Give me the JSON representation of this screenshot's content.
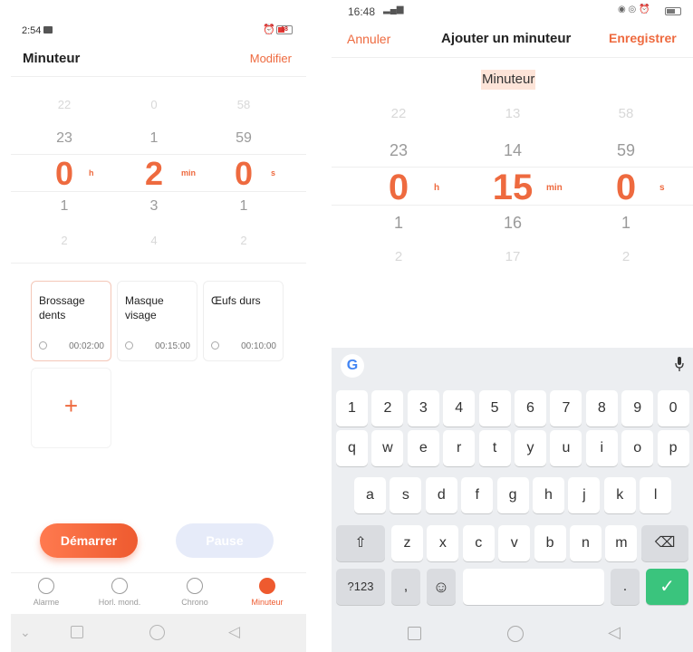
{
  "left": {
    "status": {
      "time": "2:54",
      "battery": "18"
    },
    "title": "Minuteur",
    "edit_label": "Modifier",
    "picker": {
      "hours": [
        "22",
        "23",
        "0",
        "1",
        "2"
      ],
      "minutes": [
        "0",
        "1",
        "2",
        "3",
        "4"
      ],
      "seconds": [
        "58",
        "59",
        "0",
        "1",
        "2"
      ],
      "units": {
        "h": "h",
        "min": "min",
        "s": "s"
      }
    },
    "presets": [
      {
        "name_line1": "Brossage",
        "name_line2": "dents",
        "time": "00:02:00"
      },
      {
        "name_line1": "Masque",
        "name_line2": "visage",
        "time": "00:15:00"
      },
      {
        "name_line1": "Œufs durs",
        "name_line2": "",
        "time": "00:10:00"
      }
    ],
    "add_symbol": "+",
    "start_label": "Démarrer",
    "pause_label": "Pause",
    "tabs": [
      {
        "label": "Alarme",
        "icon": "alarm-clock-icon"
      },
      {
        "label": "Horl. mond.",
        "icon": "globe-icon"
      },
      {
        "label": "Chrono",
        "icon": "stopwatch-icon"
      },
      {
        "label": "Minuteur",
        "icon": "timer-icon"
      }
    ]
  },
  "right": {
    "status": {
      "time": "16:48"
    },
    "cancel_label": "Annuler",
    "title": "Ajouter un minuteur",
    "save_label": "Enregistrer",
    "timer_name": "Minuteur",
    "picker": {
      "hours": [
        "22",
        "23",
        "0",
        "1",
        "2"
      ],
      "minutes": [
        "13",
        "14",
        "15",
        "16",
        "17"
      ],
      "seconds": [
        "58",
        "59",
        "0",
        "1",
        "2"
      ],
      "units": {
        "h": "h",
        "min": "min",
        "s": "s"
      }
    },
    "keyboard": {
      "google": "G",
      "row1": [
        "1",
        "2",
        "3",
        "4",
        "5",
        "6",
        "7",
        "8",
        "9",
        "0"
      ],
      "row2": [
        "q",
        "w",
        "e",
        "r",
        "t",
        "y",
        "u",
        "i",
        "o",
        "p"
      ],
      "row3": [
        "a",
        "s",
        "d",
        "f",
        "g",
        "h",
        "j",
        "k",
        "l"
      ],
      "row4": [
        "z",
        "x",
        "c",
        "v",
        "b",
        "n",
        "m"
      ],
      "shift": "⇧",
      "backspace": "⌫",
      "symbols": "?123",
      "comma": ",",
      "emoji": "☺",
      "period": ".",
      "enter": "✓"
    }
  },
  "colors": {
    "accent": "#ee6a3f",
    "enter_green": "#3ac47d"
  }
}
